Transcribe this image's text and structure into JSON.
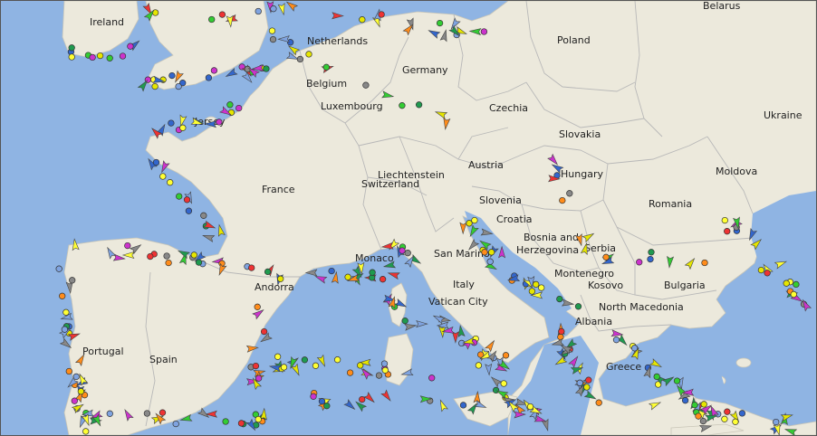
{
  "map": {
    "colors": {
      "sea": "#8fb4e3",
      "land": "#ece9dc",
      "border": "#b8b8b8",
      "label": "#222222"
    },
    "countries": {
      "belarus": "Belarus",
      "ireland": "Ireland",
      "netherlands": "Netherlands",
      "poland": "Poland",
      "germany": "Germany",
      "belgium": "Belgium",
      "luxembourg": "Luxembourg",
      "czechia": "Czechia",
      "ukraine": "Ukraine",
      "jersey": "Jersey",
      "slovakia": "Slovakia",
      "austria": "Austria",
      "hungary": "Hungary",
      "moldova": "Moldova",
      "liechtenstein": "Liechtenstein",
      "france": "France",
      "switzerland": "Switzerland",
      "slovenia": "Slovenia",
      "romania": "Romania",
      "croatia": "Croatia",
      "bosnia": "Bosnia and",
      "herzegovina": "Herzegovina",
      "serbia": "Serbia",
      "monaco": "Monaco",
      "san_marino": "San Marino",
      "montenegro": "Montenegro",
      "andorra": "Andorra",
      "italy": "Italy",
      "kosovo": "Kosovo",
      "bulgaria": "Bulgaria",
      "vatican": "Vatican City",
      "north_macedonia": "North Macedonia",
      "albania": "Albania",
      "portugal": "Portugal",
      "spain": "Spain",
      "greece": "Greece"
    },
    "vessels": {
      "colors": [
        "#ffff33",
        "#ff8c1a",
        "#33cc33",
        "#3366cc",
        "#cc33cc",
        "#7fa3e0",
        "#e6e600",
        "#888888",
        "#ee3333",
        "#1f9a4f"
      ],
      "seed": 17
    }
  }
}
